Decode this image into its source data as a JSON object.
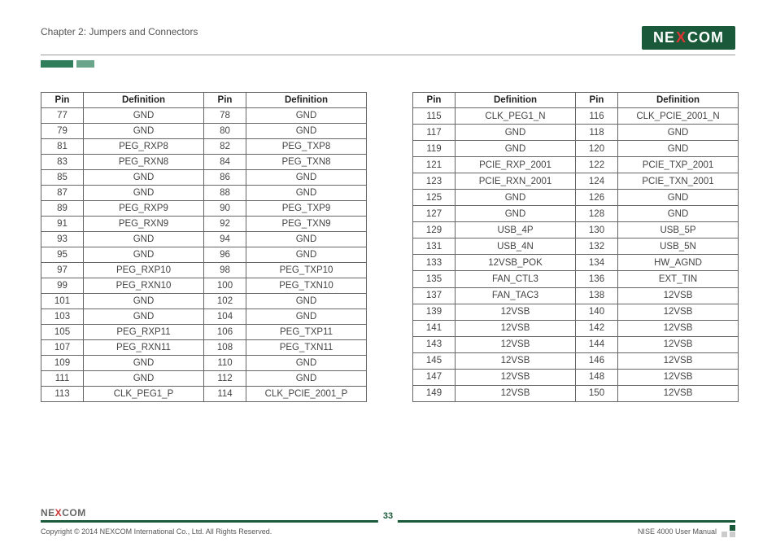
{
  "header": {
    "chapter": "Chapter 2: Jumpers and Connectors",
    "logo_parts": [
      "NE",
      "X",
      "COM"
    ]
  },
  "table_left": {
    "headers": [
      "Pin",
      "Definition",
      "Pin",
      "Definition"
    ],
    "rows": [
      [
        "77",
        "GND",
        "78",
        "GND"
      ],
      [
        "79",
        "GND",
        "80",
        "GND"
      ],
      [
        "81",
        "PEG_RXP8",
        "82",
        "PEG_TXP8"
      ],
      [
        "83",
        "PEG_RXN8",
        "84",
        "PEG_TXN8"
      ],
      [
        "85",
        "GND",
        "86",
        "GND"
      ],
      [
        "87",
        "GND",
        "88",
        "GND"
      ],
      [
        "89",
        "PEG_RXP9",
        "90",
        "PEG_TXP9"
      ],
      [
        "91",
        "PEG_RXN9",
        "92",
        "PEG_TXN9"
      ],
      [
        "93",
        "GND",
        "94",
        "GND"
      ],
      [
        "95",
        "GND",
        "96",
        "GND"
      ],
      [
        "97",
        "PEG_RXP10",
        "98",
        "PEG_TXP10"
      ],
      [
        "99",
        "PEG_RXN10",
        "100",
        "PEG_TXN10"
      ],
      [
        "101",
        "GND",
        "102",
        "GND"
      ],
      [
        "103",
        "GND",
        "104",
        "GND"
      ],
      [
        "105",
        "PEG_RXP11",
        "106",
        "PEG_TXP11"
      ],
      [
        "107",
        "PEG_RXN11",
        "108",
        "PEG_TXN11"
      ],
      [
        "109",
        "GND",
        "110",
        "GND"
      ],
      [
        "111",
        "GND",
        "112",
        "GND"
      ],
      [
        "113",
        "CLK_PEG1_P",
        "114",
        "CLK_PCIE_2001_P"
      ]
    ]
  },
  "table_right": {
    "headers": [
      "Pin",
      "Definition",
      "Pin",
      "Definition"
    ],
    "rows": [
      [
        "115",
        "CLK_PEG1_N",
        "116",
        "CLK_PCIE_2001_N"
      ],
      [
        "117",
        "GND",
        "118",
        "GND"
      ],
      [
        "119",
        "GND",
        "120",
        "GND"
      ],
      [
        "121",
        "PCIE_RXP_2001",
        "122",
        "PCIE_TXP_2001"
      ],
      [
        "123",
        "PCIE_RXN_2001",
        "124",
        "PCIE_TXN_2001"
      ],
      [
        "125",
        "GND",
        "126",
        "GND"
      ],
      [
        "127",
        "GND",
        "128",
        "GND"
      ],
      [
        "129",
        "USB_4P",
        "130",
        "USB_5P"
      ],
      [
        "131",
        "USB_4N",
        "132",
        "USB_5N"
      ],
      [
        "133",
        "12VSB_POK",
        "134",
        "HW_AGND"
      ],
      [
        "135",
        "FAN_CTL3",
        "136",
        "EXT_TIN"
      ],
      [
        "137",
        "FAN_TAC3",
        "138",
        "12VSB"
      ],
      [
        "139",
        "12VSB",
        "140",
        "12VSB"
      ],
      [
        "141",
        "12VSB",
        "142",
        "12VSB"
      ],
      [
        "143",
        "12VSB",
        "144",
        "12VSB"
      ],
      [
        "145",
        "12VSB",
        "146",
        "12VSB"
      ],
      [
        "147",
        "12VSB",
        "148",
        "12VSB"
      ],
      [
        "149",
        "12VSB",
        "150",
        "12VSB"
      ]
    ]
  },
  "footer": {
    "logo_parts": [
      "NE",
      "X",
      "COM"
    ],
    "copyright": "Copyright © 2014 NEXCOM International Co., Ltd. All Rights Reserved.",
    "page": "33",
    "manual": "NISE 4000 User Manual"
  }
}
